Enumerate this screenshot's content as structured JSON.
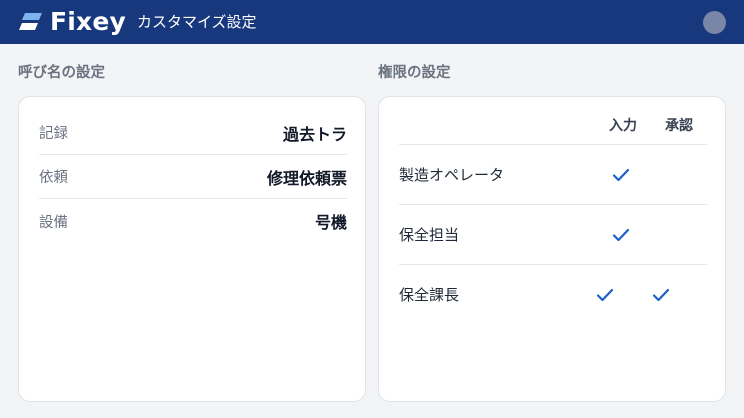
{
  "header": {
    "logo_text": "Fixey",
    "title": "カスタマイズ設定"
  },
  "naming": {
    "title": "呼び名の設定",
    "rows": [
      {
        "label": "記録",
        "value": "過去トラ"
      },
      {
        "label": "依頼",
        "value": "修理依頼票"
      },
      {
        "label": "設備",
        "value": "号機"
      }
    ]
  },
  "permissions": {
    "title": "権限の設定",
    "columns": [
      "入力",
      "承認"
    ],
    "rows": [
      {
        "name": "製造オペレータ",
        "input": true,
        "approve": false
      },
      {
        "name": "保全担当",
        "input": true,
        "approve": false
      },
      {
        "name": "保全課長",
        "input": true,
        "approve": true
      }
    ]
  },
  "colors": {
    "header_bg": "#17387c",
    "check": "#1f5fc9",
    "avatar": "#7a86a8"
  }
}
